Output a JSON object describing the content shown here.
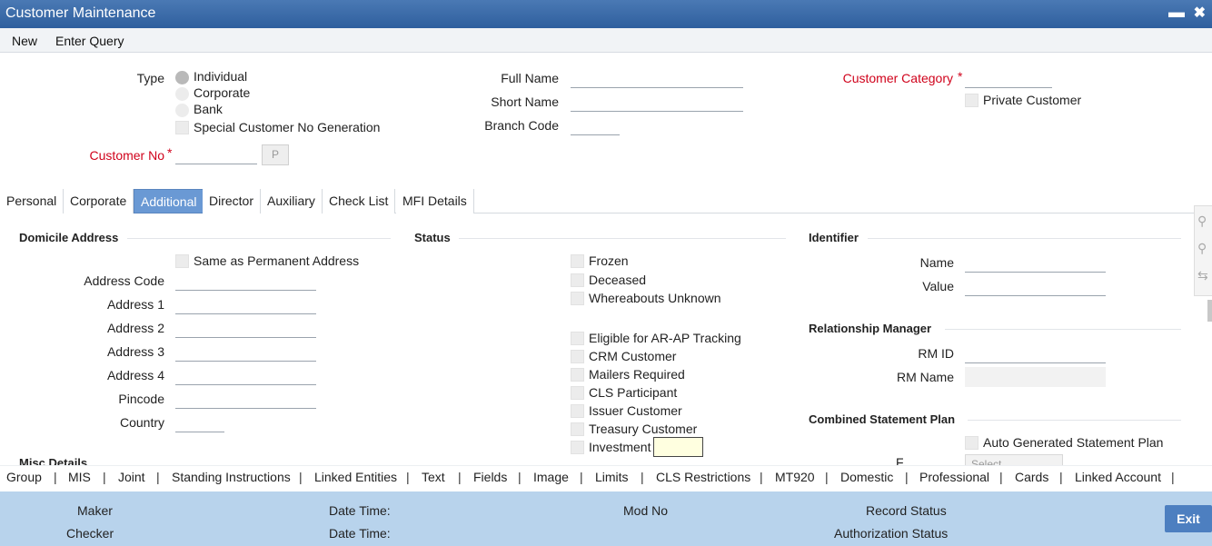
{
  "window": {
    "title": "Customer Maintenance",
    "minimize": "▬",
    "close": "✖"
  },
  "menu": {
    "new": "New",
    "enter_query": "Enter Query"
  },
  "header": {
    "type_label": "Type",
    "type_options": [
      "Individual",
      "Corporate",
      "Bank"
    ],
    "special_no_gen": "Special Customer No Generation",
    "customer_no_label": "Customer No",
    "required_mark": "*",
    "p_button": "P",
    "full_name_label": "Full Name",
    "short_name_label": "Short Name",
    "branch_code_label": "Branch Code",
    "customer_category_label": "Customer Category",
    "private_customer": "Private Customer"
  },
  "tabs": [
    "Personal",
    "Corporate",
    "Additional",
    "Director",
    "Auxiliary",
    "Check List",
    "MFI Details"
  ],
  "active_tab": "Additional",
  "domicile": {
    "title": "Domicile Address",
    "same_as_permanent": "Same as Permanent Address",
    "fields": [
      "Address Code",
      "Address 1",
      "Address 2",
      "Address 3",
      "Address 4",
      "Pincode",
      "Country"
    ],
    "cut_title": "Misc Details"
  },
  "status": {
    "title": "Status",
    "group1": [
      "Frozen",
      "Deceased",
      "Whereabouts Unknown"
    ],
    "group2": [
      "Eligible for AR-AP Tracking",
      "CRM Customer",
      "Mailers Required",
      "CLS Participant",
      "Issuer Customer",
      "Treasury Customer",
      "Investment C"
    ]
  },
  "identifier": {
    "title": "Identifier",
    "name_label": "Name",
    "value_label": "Value"
  },
  "rm": {
    "title": "Relationship Manager",
    "id_label": "RM ID",
    "name_label": "RM Name"
  },
  "csp": {
    "title": "Combined Statement Plan",
    "auto_generated": "Auto Generated Statement Plan",
    "freq_label": "F",
    "select_value": "Select"
  },
  "bottom_tabs": [
    "Group",
    "MIS",
    "Joint",
    "Standing Instructions",
    "Linked Entities",
    "Text",
    "Fields",
    "Image",
    "Limits",
    "CLS Restrictions",
    "MT920",
    "Domestic",
    "Professional",
    "Cards",
    "Linked Account"
  ],
  "separator": "|",
  "footer": {
    "maker": "Maker",
    "checker": "Checker",
    "date_time": "Date Time:",
    "mod_no": "Mod No",
    "record_status": "Record Status",
    "authorization_status": "Authorization Status",
    "exit": "Exit"
  },
  "side_tools": {
    "search1": "⚲",
    "search2": "⚲",
    "arrows": "⇆"
  },
  "colors": {
    "title_bar": "#2f5f9e",
    "active_tab": "#6a99d4",
    "footer_bg": "#b8d3ec",
    "exit_button": "#4d7fc0",
    "required": "#d0021b"
  }
}
